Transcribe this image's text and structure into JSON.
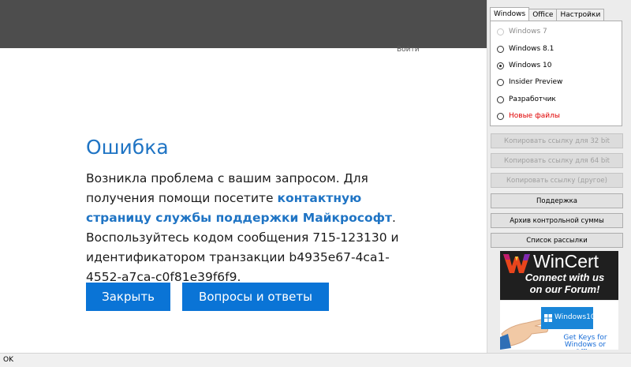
{
  "web": {
    "signin_label": "Войти",
    "error_title": "Ошибка",
    "message_part1": "Возникла проблема с вашим запросом. Для получения помощи посетите ",
    "message_link": "контактную страницу службы поддержки Майкрософт",
    "message_part2": ". Воспользуйтесь кодом сообщения 715-123130 и идентификатором транзакции b4935e67-4ca1-4552-a7ca-c0f81e39f6f9.",
    "close_button": "Закрыть",
    "faq_button": "Вопросы и ответы"
  },
  "panel": {
    "tabs": [
      {
        "label": "Windows",
        "active": true
      },
      {
        "label": "Office",
        "active": false
      },
      {
        "label": "Настройки",
        "active": false
      }
    ],
    "radios": [
      {
        "label": "Windows 7",
        "checked": false,
        "disabled": true
      },
      {
        "label": "Windows 8.1",
        "checked": false,
        "disabled": false
      },
      {
        "label": "Windows 10",
        "checked": true,
        "disabled": false
      },
      {
        "label": "Insider Preview",
        "checked": false,
        "disabled": false
      },
      {
        "label": "Разработчик",
        "checked": false,
        "disabled": false
      },
      {
        "label": "Новые файлы",
        "checked": false,
        "disabled": false,
        "color": "#e00000"
      }
    ],
    "buttons": [
      {
        "label": "Копировать ссылку для 32 bit",
        "enabled": false
      },
      {
        "label": "Копировать ссылку для 64 bit",
        "enabled": false
      },
      {
        "label": "Копировать ссылку (другое)",
        "enabled": false
      },
      {
        "label": "Поддержка",
        "enabled": true
      },
      {
        "label": "Архив контрольной суммы",
        "enabled": true
      },
      {
        "label": "Список рассылки",
        "enabled": true
      }
    ],
    "banner_wincert": {
      "name": "WinCert",
      "line1": "Connect with us",
      "line2": "on our Forum!"
    },
    "banner_keys": {
      "card_text": "Windows10",
      "line1": "Get Keys for",
      "line2": "Windows or Office"
    }
  },
  "statusbar": {
    "text": "OK"
  },
  "colors": {
    "accent": "#0a74d6",
    "link": "#1f74c4",
    "header_dark": "#4d4d4d",
    "new_files_red": "#e00000"
  }
}
